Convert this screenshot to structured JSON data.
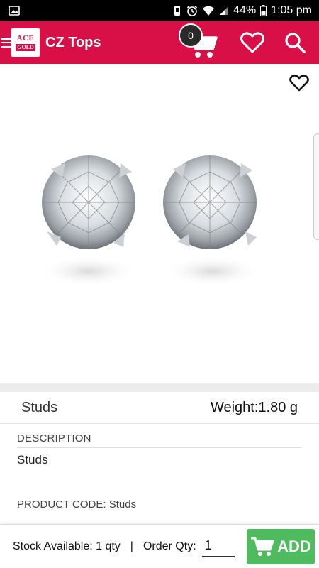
{
  "status_bar": {
    "battery_percent": "44%",
    "time": "1:05 pm"
  },
  "app_bar": {
    "logo": {
      "top": "ACE",
      "bottom": "GOLD"
    },
    "title": "CZ Tops",
    "cart_count": "0",
    "brand_color": "#d90f47"
  },
  "product": {
    "name": "Studs",
    "weight": "Weight:1.80 g",
    "description_heading": "DESCRIPTION",
    "description": "Studs",
    "product_code": "PRODUCT CODE: Studs"
  },
  "bottom_bar": {
    "stock": "Stock Available: 1 qty",
    "separator": "|",
    "order_label": "Order Qty:",
    "order_qty": "1",
    "add_label": "ADD",
    "add_color": "#4ebc5e"
  },
  "icons": [
    "image-icon",
    "alarm-icon",
    "wifi-icon",
    "signal-icon",
    "battery-icon",
    "menu-icon",
    "cart-icon",
    "heart-icon",
    "search-icon",
    "wishlist-heart-icon",
    "add-cart-icon"
  ]
}
